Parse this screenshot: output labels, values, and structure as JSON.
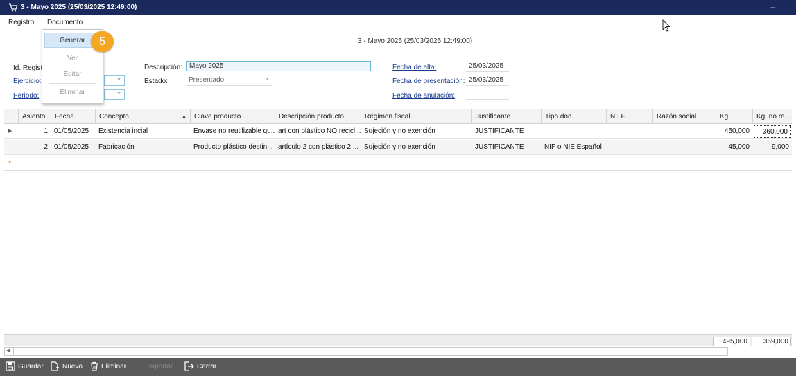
{
  "window": {
    "title": "3 - Mayo 2025 (25/03/2025 12:49:00)",
    "minimize_symbol": "–",
    "icon": "cart-icon"
  },
  "menubar": {
    "items": [
      "Registro",
      "Documento"
    ]
  },
  "documento_menu": {
    "items": [
      "Generar",
      "Ver",
      "Editar",
      "Eliminar"
    ],
    "highlighted": "Generar"
  },
  "step_badge": "5",
  "form": {
    "title": "3 - Mayo 2025 (25/03/2025 12:49:00)",
    "id_label": "Id. Regist",
    "ejercicio_label": "Ejercicio:",
    "periodo_label": "Periodo:",
    "descripcion_label": "Descripción:",
    "descripcion_value": "Mayo 2025",
    "estado_label": "Estado:",
    "estado_value": "Presentado",
    "fecha_alta_label": "Fecha de alta:",
    "fecha_alta_value": "25/03/2025",
    "fecha_presentacion_label": "Fecha de presentación:",
    "fecha_presentacion_value": "25/03/2025",
    "fecha_anulacion_label": "Fecha de anulación:",
    "fecha_anulacion_value": ""
  },
  "grid": {
    "columns": [
      "Asiento",
      "Fecha",
      "Concepto",
      "Clave producto",
      "Descripción producto",
      "Régimen fiscal",
      "Justificante",
      "Tipo doc.",
      "N.I.F.",
      "Razón social",
      "Kg.",
      "Kg. no re..."
    ],
    "rows": [
      {
        "asiento": "1",
        "fecha": "01/05/2025",
        "concepto": "Existencia incial",
        "clave": "Envase no reutilizable qu...",
        "descripcion": "art con plástico NO recicl...",
        "regimen": "Sujeción y no exención",
        "justificante": "JUSTIFICANTE",
        "tipo_doc": "",
        "nif": "",
        "razon": "",
        "kg": "450,000",
        "kg_no_re": "360,000"
      },
      {
        "asiento": "2",
        "fecha": "01/05/2025",
        "concepto": "Fabricación",
        "clave": "Producto plástico destin...",
        "descripcion": "artículo 2 con plástico 2 ...",
        "regimen": "Sujeción y no exención",
        "justificante": "JUSTIFICANTE",
        "tipo_doc": "NIF o NIE Español",
        "nif": "",
        "razon": "",
        "kg": "45,000",
        "kg_no_re": "9,000"
      }
    ],
    "new_row_marker": "*",
    "totals": {
      "kg": "495,000",
      "kg_no_re": "369,000"
    }
  },
  "toolbar": {
    "guardar": "Guardar",
    "nuevo": "Nuevo",
    "eliminar": "Eliminar",
    "importar": "Importar",
    "cerrar": "Cerrar"
  }
}
